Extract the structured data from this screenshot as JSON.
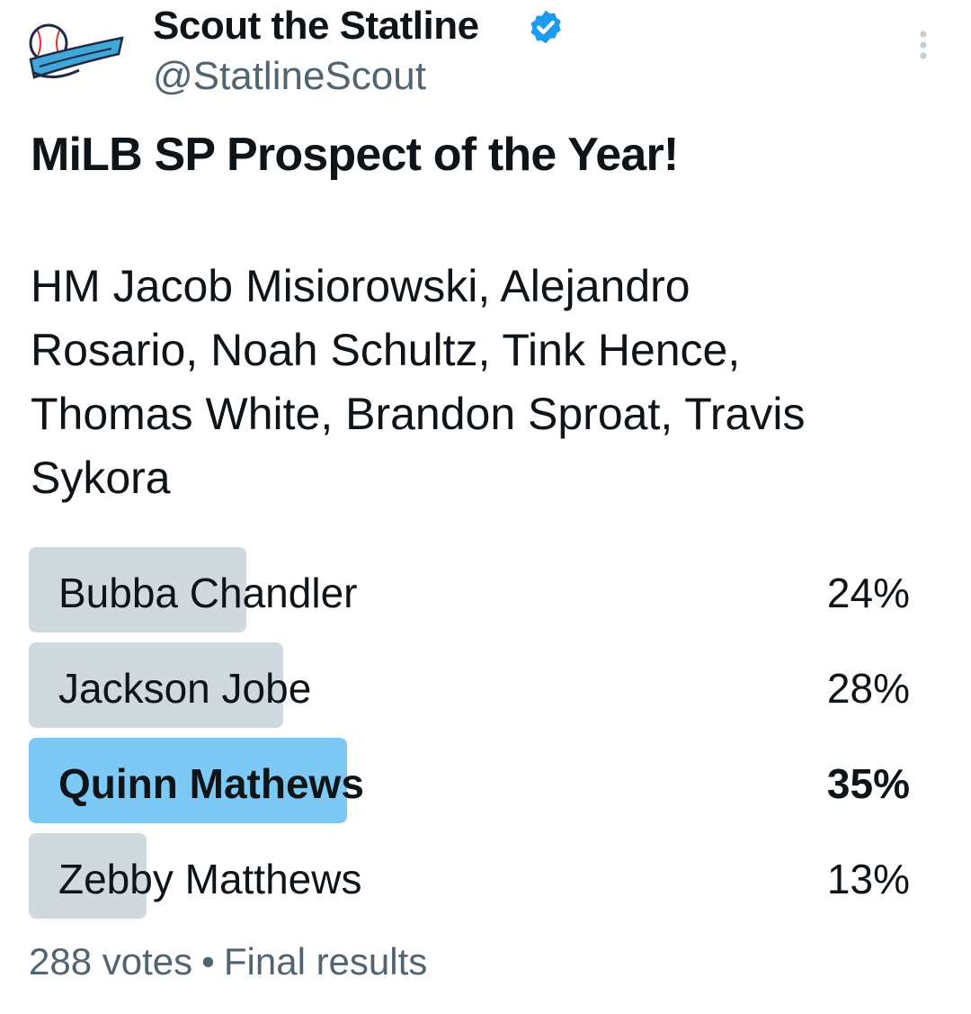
{
  "author": {
    "name": "Scout the Statline",
    "handle": "@StatlineScout",
    "verified": true,
    "avatar_icon": "baseball-logo-icon"
  },
  "tweet": {
    "title": "MiLB SP Prospect of the Year!",
    "honorable_mentions": [
      "HM Jacob Misiorowski, Alejandro",
      "Rosario, Noah Schultz, Tink Hence,",
      "Thomas White, Brandon Sproat, Travis",
      "Sykora"
    ]
  },
  "poll": {
    "options": [
      {
        "label": "Bubba Chandler",
        "percent_text": "24%",
        "percent": 24,
        "winner": false
      },
      {
        "label": "Jackson Jobe",
        "percent_text": "28%",
        "percent": 28,
        "winner": false
      },
      {
        "label": "Quinn Mathews",
        "percent_text": "35%",
        "percent": 35,
        "winner": true
      },
      {
        "label": "Zebby Matthews",
        "percent_text": "13%",
        "percent": 13,
        "winner": false
      }
    ],
    "votes": "288 votes",
    "separator": "•",
    "status": "Final results"
  },
  "colors": {
    "bar": "#cfd9de",
    "winner_bar": "#7dc9f5",
    "verified": "#1d9bf0",
    "secondary_text": "#536471"
  }
}
